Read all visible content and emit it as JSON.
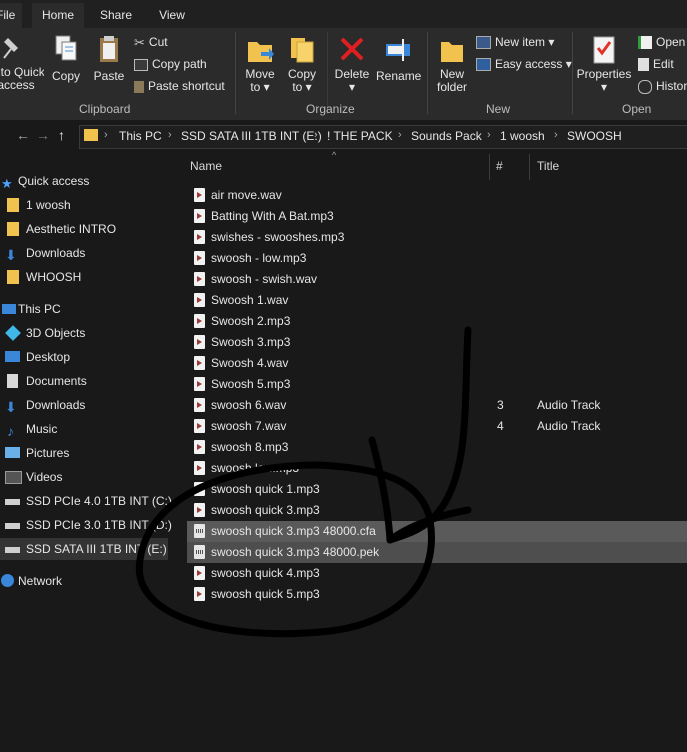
{
  "tabs": {
    "file": "File",
    "home": "Home",
    "share": "Share",
    "view": "View"
  },
  "ribbon": {
    "clipboard": {
      "pin_label_1": "Pin to Quick",
      "pin_label_2": "access",
      "copy": "Copy",
      "paste": "Paste",
      "cut": "Cut",
      "copy_path": "Copy path",
      "paste_shortcut": "Paste shortcut",
      "group": "Clipboard"
    },
    "organize": {
      "move_to_1": "Move",
      "move_to_2": "to",
      "copy_to_1": "Copy",
      "copy_to_2": "to",
      "delete": "Delete",
      "rename": "Rename",
      "group": "Organize"
    },
    "new": {
      "new_folder_1": "New",
      "new_folder_2": "folder",
      "new_item": "New item",
      "easy_access": "Easy access",
      "group": "New"
    },
    "open": {
      "properties": "Properties",
      "open": "Open",
      "edit": "Edit",
      "history": "History",
      "group": "Open"
    }
  },
  "address": {
    "crumbs": [
      "This PC",
      "SSD SATA III 1TB INT (E:)",
      "! THE PACK",
      "Sounds Pack",
      "1 woosh",
      "SWOOSH"
    ]
  },
  "nav": {
    "quick_access": "Quick access",
    "pinned": [
      "1 woosh",
      "Aesthetic INTRO",
      "Downloads",
      "WHOOSH"
    ],
    "this_pc": "This PC",
    "pc_items": [
      "3D Objects",
      "Desktop",
      "Documents",
      "Downloads",
      "Music",
      "Pictures",
      "Videos"
    ],
    "drives": [
      "SSD PCIe 4.0 1TB INT (C:)",
      "SSD PCIe 3.0 1TB INT (D:)",
      "SSD SATA III 1TB INT (E:)"
    ],
    "network": "Network"
  },
  "columns": {
    "name": "Name",
    "number": "#",
    "title": "Title"
  },
  "files": [
    {
      "name": "air move.wav",
      "num": "",
      "title": ""
    },
    {
      "name": "Batting With A Bat.mp3",
      "num": "",
      "title": ""
    },
    {
      "name": "swishes - swooshes.mp3",
      "num": "",
      "title": ""
    },
    {
      "name": "swoosh - low.mp3",
      "num": "",
      "title": ""
    },
    {
      "name": "swoosh - swish.wav",
      "num": "",
      "title": ""
    },
    {
      "name": "Swoosh 1.wav",
      "num": "",
      "title": ""
    },
    {
      "name": "Swoosh 2.mp3",
      "num": "",
      "title": ""
    },
    {
      "name": "Swoosh 3.mp3",
      "num": "",
      "title": ""
    },
    {
      "name": "Swoosh 4.wav",
      "num": "",
      "title": ""
    },
    {
      "name": "Swoosh 5.mp3",
      "num": "",
      "title": ""
    },
    {
      "name": "swoosh 6.wav",
      "num": "3",
      "title": "Audio Track"
    },
    {
      "name": "swoosh 7.wav",
      "num": "4",
      "title": "Audio Track"
    },
    {
      "name": "swoosh 8.mp3",
      "num": "",
      "title": ""
    },
    {
      "name": "swoosh low.mp3",
      "num": "",
      "title": ""
    },
    {
      "name": "swoosh quick 1.mp3",
      "num": "",
      "title": ""
    },
    {
      "name": "swoosh quick 3.mp3",
      "num": "",
      "title": ""
    },
    {
      "name": "swoosh quick 3.mp3 48000.cfa",
      "num": "",
      "title": ""
    },
    {
      "name": "swoosh quick 3.mp3 48000.pek",
      "num": "",
      "title": ""
    },
    {
      "name": "swoosh quick 4.mp3",
      "num": "",
      "title": ""
    },
    {
      "name": "swoosh quick 5.mp3",
      "num": "",
      "title": ""
    }
  ]
}
